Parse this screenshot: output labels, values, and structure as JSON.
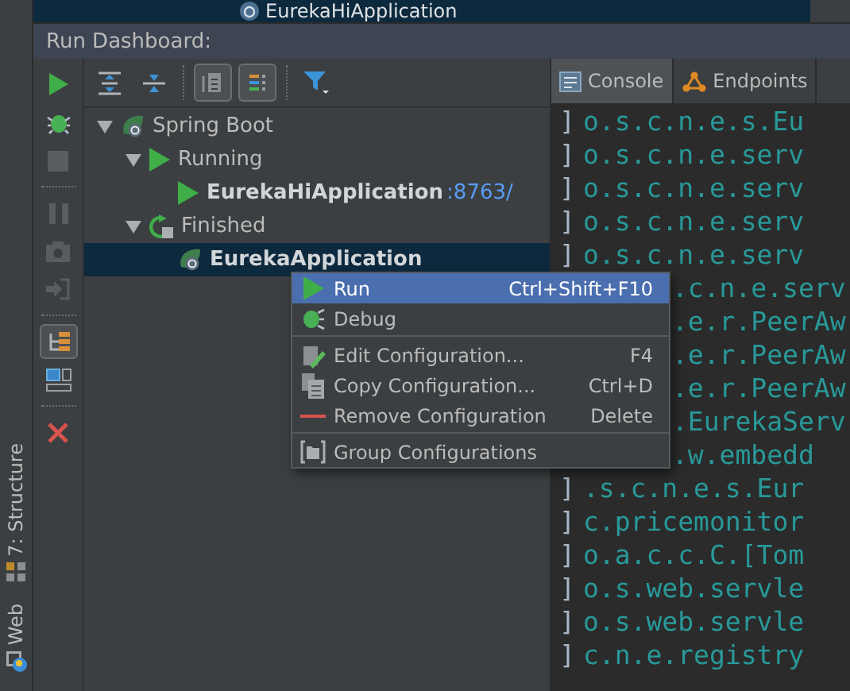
{
  "top_item": {
    "label": "EurekaHiApplication"
  },
  "panel": {
    "title": "Run Dashboard:"
  },
  "side_strip": [
    {
      "label": "7: Structure",
      "kind": "structure"
    },
    {
      "label": "Web",
      "kind": "web"
    }
  ],
  "left_toolbar": [
    {
      "kind": "run",
      "on": false
    },
    {
      "kind": "debug",
      "on": false
    },
    {
      "kind": "stop",
      "on": false
    },
    {
      "kind": "sep"
    },
    {
      "kind": "pause",
      "on": false
    },
    {
      "kind": "camera",
      "on": false
    },
    {
      "kind": "exit",
      "on": false
    },
    {
      "kind": "sep"
    },
    {
      "kind": "tree",
      "on": true
    },
    {
      "kind": "layout",
      "on": false
    },
    {
      "kind": "sep"
    },
    {
      "kind": "close",
      "on": false
    }
  ],
  "tree_toolbar": [
    {
      "kind": "expand",
      "on": false
    },
    {
      "kind": "collapse",
      "on": false
    },
    {
      "kind": "sep"
    },
    {
      "kind": "group",
      "on": true
    },
    {
      "kind": "types",
      "on": true
    },
    {
      "kind": "sep"
    },
    {
      "kind": "filter",
      "on": false
    }
  ],
  "tree": [
    {
      "label": "Spring Boot",
      "kind": "spring",
      "expanded": true,
      "selected": false,
      "children": [
        {
          "label": "Running",
          "kind": "running",
          "expanded": true,
          "selected": false,
          "children": [
            {
              "label": "EurekaHiApplication",
              "port": ":8763/",
              "kind": "app-running",
              "selected": false
            }
          ]
        },
        {
          "label": "Finished",
          "kind": "finished",
          "expanded": true,
          "selected": false,
          "children": [
            {
              "label": "EurekaApplication",
              "kind": "app",
              "selected": true
            }
          ]
        }
      ]
    }
  ],
  "tabs": [
    {
      "label": "Console",
      "kind": "console",
      "selected": true
    },
    {
      "label": "Endpoints",
      "kind": "endpoints",
      "selected": false
    }
  ],
  "console": [
    {
      "gutter": "]",
      "text": "o.s.c.n.e.s.Eu",
      "covered": false
    },
    {
      "gutter": "]",
      "text": "o.s.c.n.e.serv",
      "covered": false
    },
    {
      "gutter": "]",
      "text": "o.s.c.n.e.serv",
      "covered": false
    },
    {
      "gutter": "]",
      "text": "o.s.c.n.e.serv",
      "covered": false
    },
    {
      "gutter": "]",
      "text": "o.s.c.n.e.serv",
      "covered": false
    },
    {
      "covered": true,
      "text": ".c.n.e.serv"
    },
    {
      "covered": true,
      "text": ".e.r.PeerAw"
    },
    {
      "covered": true,
      "text": ".e.r.PeerAw"
    },
    {
      "covered": true,
      "text": ".e.r.PeerAw"
    },
    {
      "covered": true,
      "text": ".EurekaServ"
    },
    {
      "covered": true,
      "text": ".w.embedd"
    },
    {
      "gutter": "]",
      "text": ".s.c.n.e.s.Eur",
      "covered": false
    },
    {
      "gutter": "]",
      "text": "c.pricemonitor",
      "covered": false
    },
    {
      "gutter": "]",
      "text": "o.a.c.c.C.[Tom",
      "covered": false
    },
    {
      "gutter": "]",
      "text": "o.s.web.servle",
      "covered": false
    },
    {
      "gutter": "]",
      "text": "o.s.web.servle",
      "covered": false
    },
    {
      "gutter": "]",
      "text": "c.n.e.registry",
      "covered": false
    }
  ],
  "context_menu": [
    {
      "kind": "run",
      "label": "Run",
      "shortcut": "Ctrl+Shift+F10",
      "selected": true
    },
    {
      "kind": "debug",
      "label": "Debug",
      "selected": false
    },
    {
      "kind": "sep"
    },
    {
      "kind": "edit",
      "label": "Edit Configuration...",
      "shortcut": "F4",
      "selected": false
    },
    {
      "kind": "copy",
      "label": "Copy Configuration...",
      "shortcut": "Ctrl+D",
      "selected": false
    },
    {
      "kind": "remove",
      "label": "Remove Configuration",
      "shortcut": "Delete",
      "selected": false
    },
    {
      "kind": "sep"
    },
    {
      "kind": "group",
      "label": "Group Configurations",
      "selected": false
    }
  ]
}
